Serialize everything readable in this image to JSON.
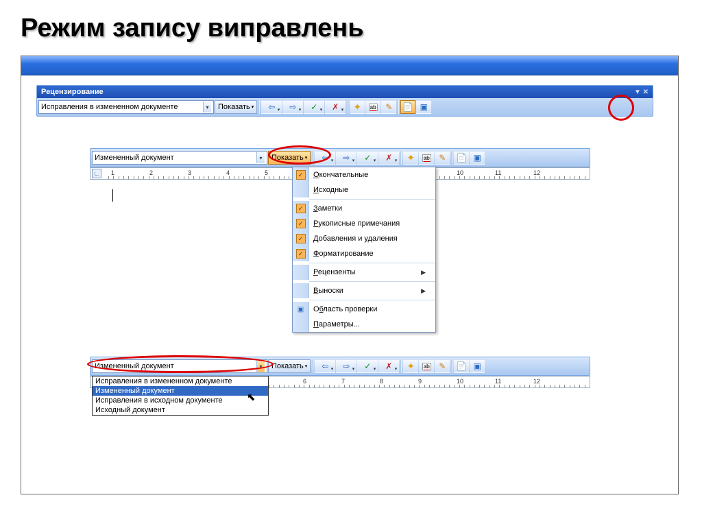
{
  "slide": {
    "title": "Режим запису виправлень"
  },
  "toolbar1": {
    "header": "Рецензирование",
    "combo_value": "Исправления в измененном документе",
    "show_label": "Показать"
  },
  "toolbar2": {
    "combo_value": "Измененный документ",
    "show_label": "Показать"
  },
  "show_menu": {
    "items": [
      {
        "label": "Окончательные",
        "checked": true,
        "underline_char": "О"
      },
      {
        "label": "Исходные",
        "checked": false,
        "underline_char": "И"
      },
      {
        "label": "Заметки",
        "checked": true,
        "underline_char": "З"
      },
      {
        "label": "Рукописные примечания",
        "checked": true,
        "underline_char": "Р"
      },
      {
        "label": "Добавления и удаления",
        "checked": true,
        "underline_char": "Д"
      },
      {
        "label": "Форматирование",
        "checked": true,
        "underline_char": "Ф"
      },
      {
        "label": "Рецензенты",
        "checked": false,
        "submenu": true,
        "underline_char": "Р"
      },
      {
        "label": "Выноски",
        "checked": false,
        "submenu": true,
        "underline_char": "В"
      },
      {
        "label": "Область проверки",
        "checked": false,
        "icon": "pane",
        "underline_char": "б"
      },
      {
        "label": "Параметры...",
        "checked": false,
        "underline_char": "П"
      }
    ]
  },
  "toolbar3": {
    "combo_value": "Измененный документ",
    "show_label": "Показать",
    "list_items": [
      "Исправления в измененном документе",
      "Измененный документ",
      "Исправления в исходном документе",
      "Исходный документ"
    ],
    "selected_index": 1
  },
  "ruler": {
    "marks": [
      "1",
      "2",
      "3",
      "4",
      "5",
      "6",
      "7",
      "8",
      "9",
      "10",
      "11",
      "12"
    ]
  }
}
